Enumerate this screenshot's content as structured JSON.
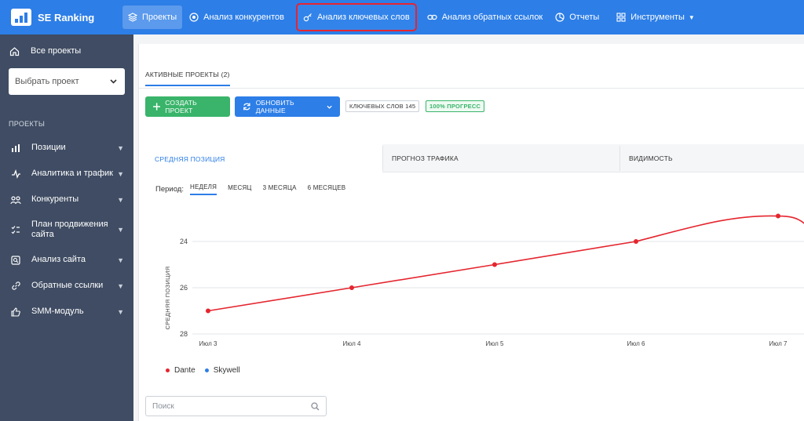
{
  "app": {
    "name": "SE Ranking"
  },
  "nav": {
    "items": [
      {
        "label": "Проекты",
        "icon": "layers-icon",
        "active": true
      },
      {
        "label": "Анализ конкурентов",
        "icon": "target-icon"
      },
      {
        "label": "Анализ ключевых слов",
        "icon": "key-icon",
        "highlighted": true
      },
      {
        "label": "Анализ обратных ссылок",
        "icon": "link-icon"
      },
      {
        "label": "Отчеты",
        "icon": "pie-chart-icon"
      },
      {
        "label": "Инструменты",
        "icon": "grid-icon",
        "dropdown": true
      }
    ]
  },
  "sidebar": {
    "all_projects": "Все проекты",
    "project_select": {
      "value": "Выбрать проект"
    },
    "section_title": "ПРОЕКТЫ",
    "items": [
      {
        "label": "Позиции",
        "icon": "bar-chart-icon"
      },
      {
        "label": "Аналитика и трафик",
        "icon": "pulse-icon"
      },
      {
        "label": "Конкуренты",
        "icon": "users-icon"
      },
      {
        "label": "План продвижения сайта",
        "icon": "checklist-icon"
      },
      {
        "label": "Анализ сайта",
        "icon": "audit-icon"
      },
      {
        "label": "Обратные ссылки",
        "icon": "link-icon"
      },
      {
        "label": "SMM-модуль",
        "icon": "thumbs-up-icon"
      }
    ]
  },
  "main": {
    "active_tab": "АКТИВНЫЕ ПРОЕКТЫ (2)",
    "create_button": "СОЗДАТЬ ПРОЕКТ",
    "update_button": "ОБНОВИТЬ ДАННЫЕ",
    "keywords_badge": "КЛЮЧЕВЫХ СЛОВ 145",
    "progress_badge": "100% ПРОГРЕСС",
    "chart_tabs": [
      "СРЕДНЯЯ ПОЗИЦИЯ",
      "ПРОГНОЗ ТРАФИКА",
      "ВИДИМОСТЬ"
    ],
    "period_label": "Период:",
    "period_options": [
      "НЕДЕЛЯ",
      "МЕСЯЦ",
      "3 МЕСЯЦА",
      "6 МЕСЯЦЕВ"
    ],
    "search_placeholder": "Поиск"
  },
  "colors": {
    "accent": "#2d7ee7",
    "green": "#39b46a",
    "sidebar": "#3f4c63",
    "series": "#e5252e",
    "highlight": "#e8232f"
  },
  "chart_data": {
    "type": "line",
    "ylabel": "СРЕДНЯЯ ПОЗИЦИЯ",
    "categories": [
      "Июл 3",
      "Июл 4",
      "Июл 5",
      "Июл 6",
      "Июл 7"
    ],
    "yticks": [
      "24",
      "26",
      "28"
    ],
    "ylim": [
      28,
      23
    ],
    "y_inverted": true,
    "grid": true,
    "series": [
      {
        "name": "Dante",
        "color": "#e5252e",
        "values": [
          27,
          26,
          25,
          24,
          22.9
        ]
      },
      {
        "name": "Skywell",
        "color": "#2d7ee7",
        "values": []
      }
    ],
    "legend_position": "bottom-left"
  }
}
